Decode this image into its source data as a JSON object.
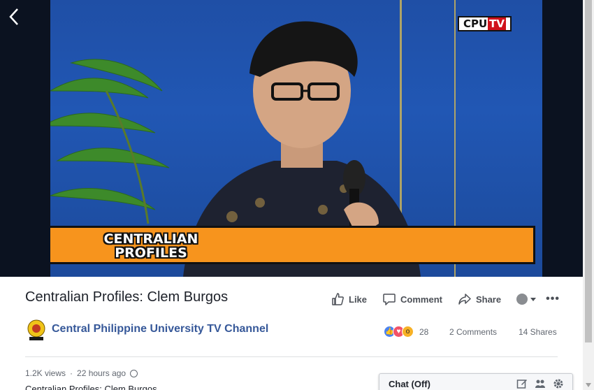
{
  "video": {
    "channel_logo": {
      "main": "CPU",
      "accent": "TV"
    },
    "lower_third": {
      "line1": "CENTRALIAN",
      "line2": "PROFILES"
    },
    "colors": {
      "lower_third": "#f7941d",
      "backdrop": "#1f4fa6"
    }
  },
  "post": {
    "title": "Centralian Profiles: Clem Burgos",
    "actions": {
      "like": "Like",
      "comment": "Comment",
      "share": "Share"
    },
    "channel_name": "Central Philippine University TV Channel",
    "reactions_count": "28",
    "comments": "2 Comments",
    "shares": "14 Shares",
    "views": "1.2K views",
    "time": "22 hours ago",
    "dot": "·",
    "description": "Centralian Profiles: Clem Burgos"
  },
  "chat": {
    "label": "Chat (Off)"
  },
  "icons": [
    "back-arrow-icon",
    "like-icon",
    "comment-icon",
    "share-icon",
    "audience-icon",
    "more-icon",
    "globe-icon",
    "compose-icon",
    "people-icon",
    "gear-icon"
  ]
}
